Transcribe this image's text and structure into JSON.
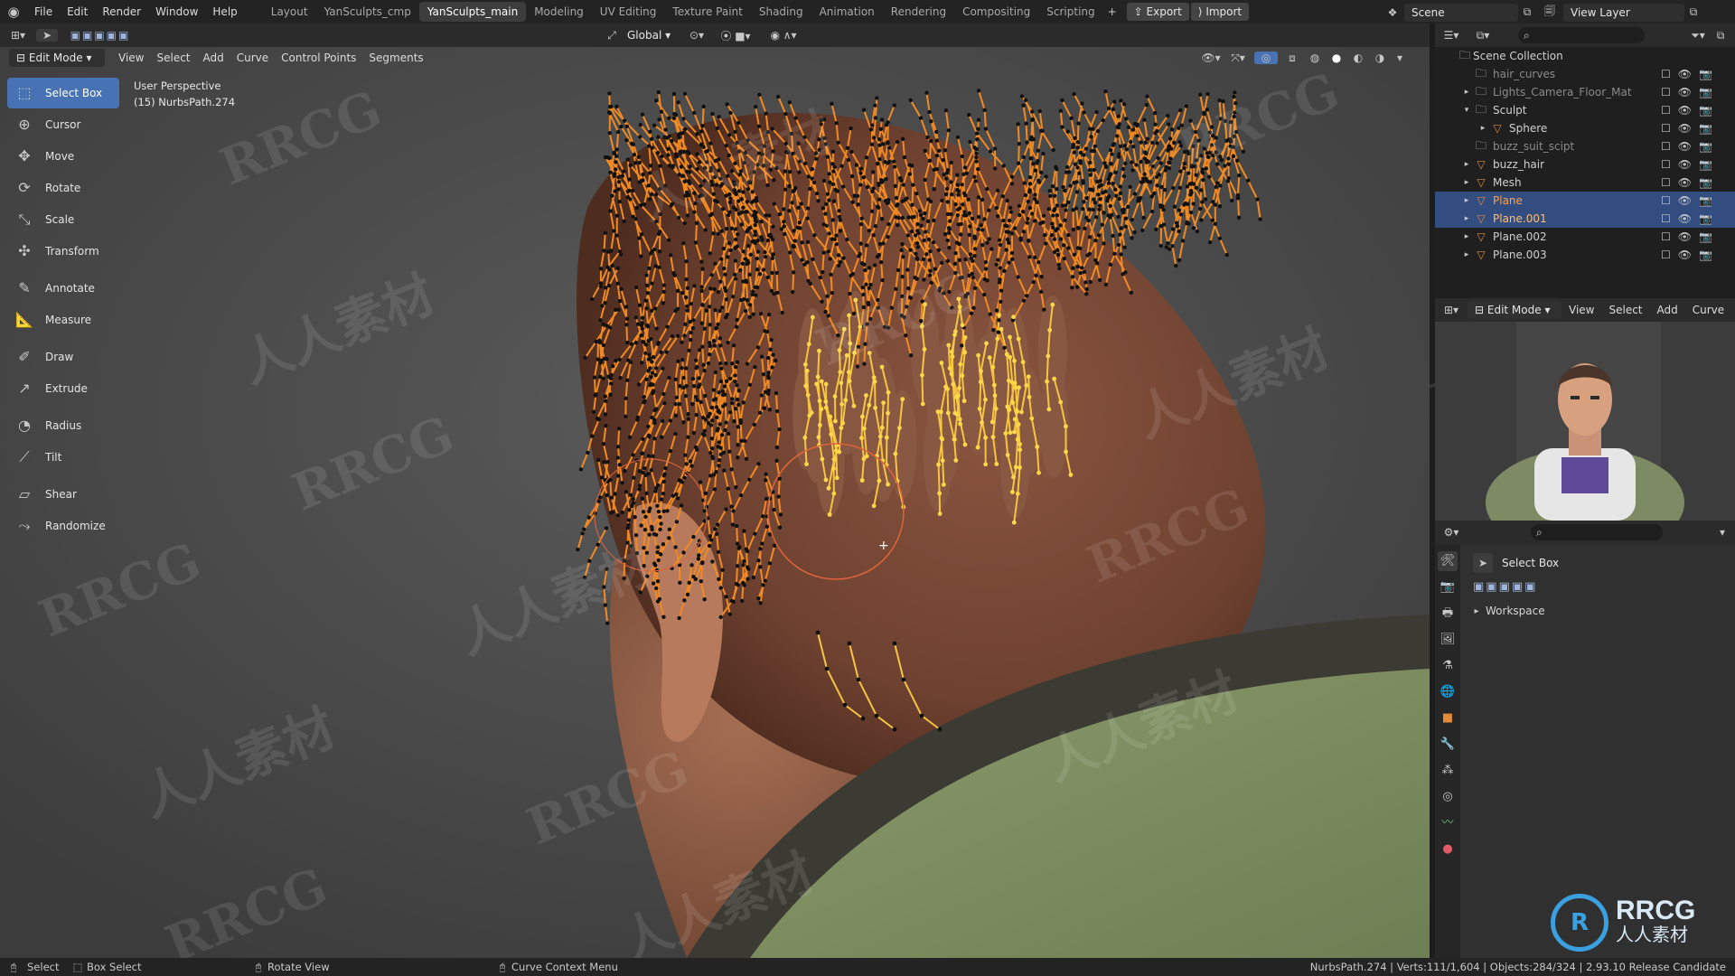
{
  "topbar": {
    "menus": [
      "File",
      "Edit",
      "Render",
      "Window",
      "Help"
    ],
    "workspaces": [
      "Layout",
      "YanSculpts_cmp",
      "YanSculpts_main",
      "Modeling",
      "UV Editing",
      "Texture Paint",
      "Shading",
      "Animation",
      "Rendering",
      "Compositing",
      "Scripting"
    ],
    "active_workspace": "YanSculpts_main",
    "export_label": "Export",
    "import_label": "Import",
    "scene_label": "Scene",
    "view_layer_label": "View Layer"
  },
  "viewport_header": {
    "transform_orientation": "Global"
  },
  "editor_header": {
    "mode": "Edit Mode",
    "menus": [
      "View",
      "Select",
      "Add",
      "Curve",
      "Control Points",
      "Segments"
    ]
  },
  "viewport_info": {
    "perspective": "User Perspective",
    "object": "(15) NurbsPath.274"
  },
  "tools": [
    {
      "name": "select-box",
      "label": "Select Box",
      "icon": "select-box-icon",
      "glyph": "⬚",
      "active": true
    },
    {
      "name": "cursor",
      "label": "Cursor",
      "icon": "cursor-icon",
      "glyph": "⊕"
    },
    {
      "name": "move",
      "label": "Move",
      "icon": "move-icon",
      "glyph": "✥"
    },
    {
      "name": "rotate",
      "label": "Rotate",
      "icon": "rotate-icon",
      "glyph": "⟳"
    },
    {
      "name": "scale",
      "label": "Scale",
      "icon": "scale-icon",
      "glyph": "⤡"
    },
    {
      "name": "transform",
      "label": "Transform",
      "icon": "transform-icon",
      "glyph": "✣"
    },
    {
      "name": "annotate",
      "label": "Annotate",
      "icon": "annotate-icon",
      "glyph": "✎",
      "gap": true
    },
    {
      "name": "measure",
      "label": "Measure",
      "icon": "measure-icon",
      "glyph": "📐"
    },
    {
      "name": "draw",
      "label": "Draw",
      "icon": "draw-icon",
      "glyph": "✐",
      "gap": true
    },
    {
      "name": "extrude",
      "label": "Extrude",
      "icon": "extrude-icon",
      "glyph": "↗"
    },
    {
      "name": "radius",
      "label": "Radius",
      "icon": "radius-icon",
      "glyph": "◔",
      "gap": true
    },
    {
      "name": "tilt",
      "label": "Tilt",
      "icon": "tilt-icon",
      "glyph": "⟋"
    },
    {
      "name": "shear",
      "label": "Shear",
      "icon": "shear-icon",
      "glyph": "▱",
      "gap": true
    },
    {
      "name": "randomize",
      "label": "Randomize",
      "icon": "randomize-icon",
      "glyph": "⤳"
    }
  ],
  "outliner": {
    "root": "Scene Collection",
    "rows": [
      {
        "label": "hair_curves",
        "indent": 1,
        "dim": true
      },
      {
        "label": "Lights_Camera_Floor_Mat",
        "indent": 1,
        "dim": true,
        "expand": "▸"
      },
      {
        "label": "Sculpt",
        "indent": 1,
        "expand": "▾"
      },
      {
        "label": "Sphere",
        "indent": 2,
        "expand": "▸",
        "mesh": true
      },
      {
        "label": "buzz_suit_scipt",
        "indent": 1,
        "dim": true
      },
      {
        "label": "buzz_hair",
        "indent": 1,
        "expand": "▸",
        "mesh": true
      },
      {
        "label": "Mesh",
        "indent": 1,
        "expand": "▸",
        "mesh": true
      },
      {
        "label": "Plane",
        "indent": 1,
        "expand": "▸",
        "mesh": true,
        "selected": true,
        "active": true
      },
      {
        "label": "Plane.001",
        "indent": 1,
        "expand": "▸",
        "mesh": true,
        "selected": true,
        "highlight": true
      },
      {
        "label": "Plane.002",
        "indent": 1,
        "expand": "▸",
        "mesh": true
      },
      {
        "label": "Plane.003",
        "indent": 1,
        "expand": "▸",
        "mesh": true
      }
    ]
  },
  "preview_header": {
    "mode": "Edit Mode",
    "menus": [
      "View",
      "Select",
      "Add",
      "Curve"
    ]
  },
  "properties": {
    "tool_name": "Select Box",
    "workspace_label": "Workspace"
  },
  "statusbar": {
    "select": "Select",
    "box_select": "Box Select",
    "rotate_view": "Rotate View",
    "context_menu": "Curve Context Menu",
    "stats": "NurbsPath.274 | Verts:111/1,604 | Objects:284/324 | 2.93.10 Release Candidate"
  },
  "watermarks": {
    "brand": "RRCG",
    "cn": "人人素材"
  },
  "colors": {
    "accent": "#4772b3",
    "curve_orange": "#f08a24",
    "curve_yellow": "#f5c542",
    "skin": "#7a4a33"
  }
}
